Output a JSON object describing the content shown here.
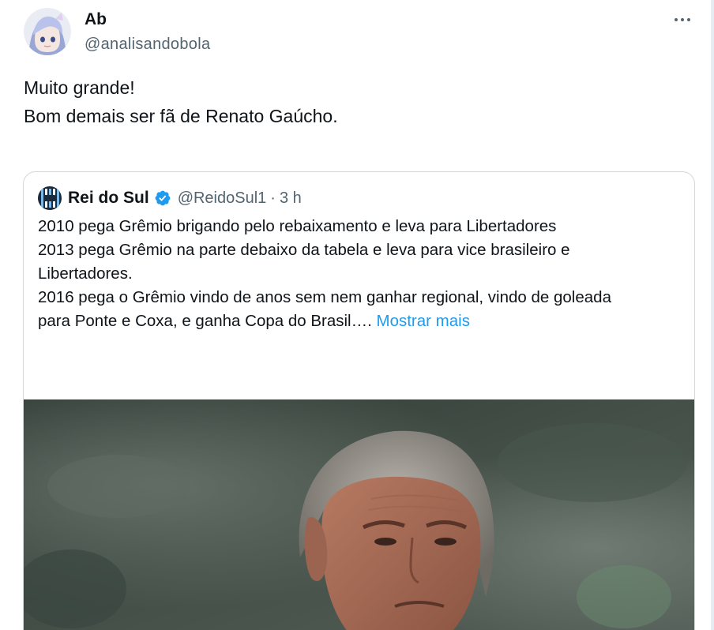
{
  "tweet": {
    "author_name": "Ab",
    "author_handle": "@analisandobola",
    "text_lines": [
      "Muito grande!",
      "Bom demais ser fã de Renato Gaúcho."
    ],
    "more_icon": "more-horizontal-icon"
  },
  "quote": {
    "author_name": "Rei do Sul",
    "author_handle": "@ReidoSul1",
    "separator": "·",
    "time": "3 h",
    "verified_icon": "verified-badge-icon",
    "paragraph_1": "2010 pega Grêmio brigando pelo rebaixamento e leva para Libertadores",
    "paragraph_2_line_1": "2013 pega Grêmio na parte debaixo da tabela e leva para vice brasileiro e",
    "paragraph_2_line_2": "Libertadores.",
    "paragraph_3_line_1": "2016 pega o Grêmio vindo de anos sem nem ganhar regional, vindo de goleada",
    "paragraph_3_line_2": "para Ponte e Coxa, e ganha Copa do Brasil….",
    "show_more": "Mostrar mais",
    "media_alt_icon": "photo-coach-portrait"
  },
  "colors": {
    "text": "#0f1419",
    "secondary": "#536471",
    "link": "#1d9bf0",
    "border": "#cfd9de",
    "verified": "#1d9bf0"
  }
}
